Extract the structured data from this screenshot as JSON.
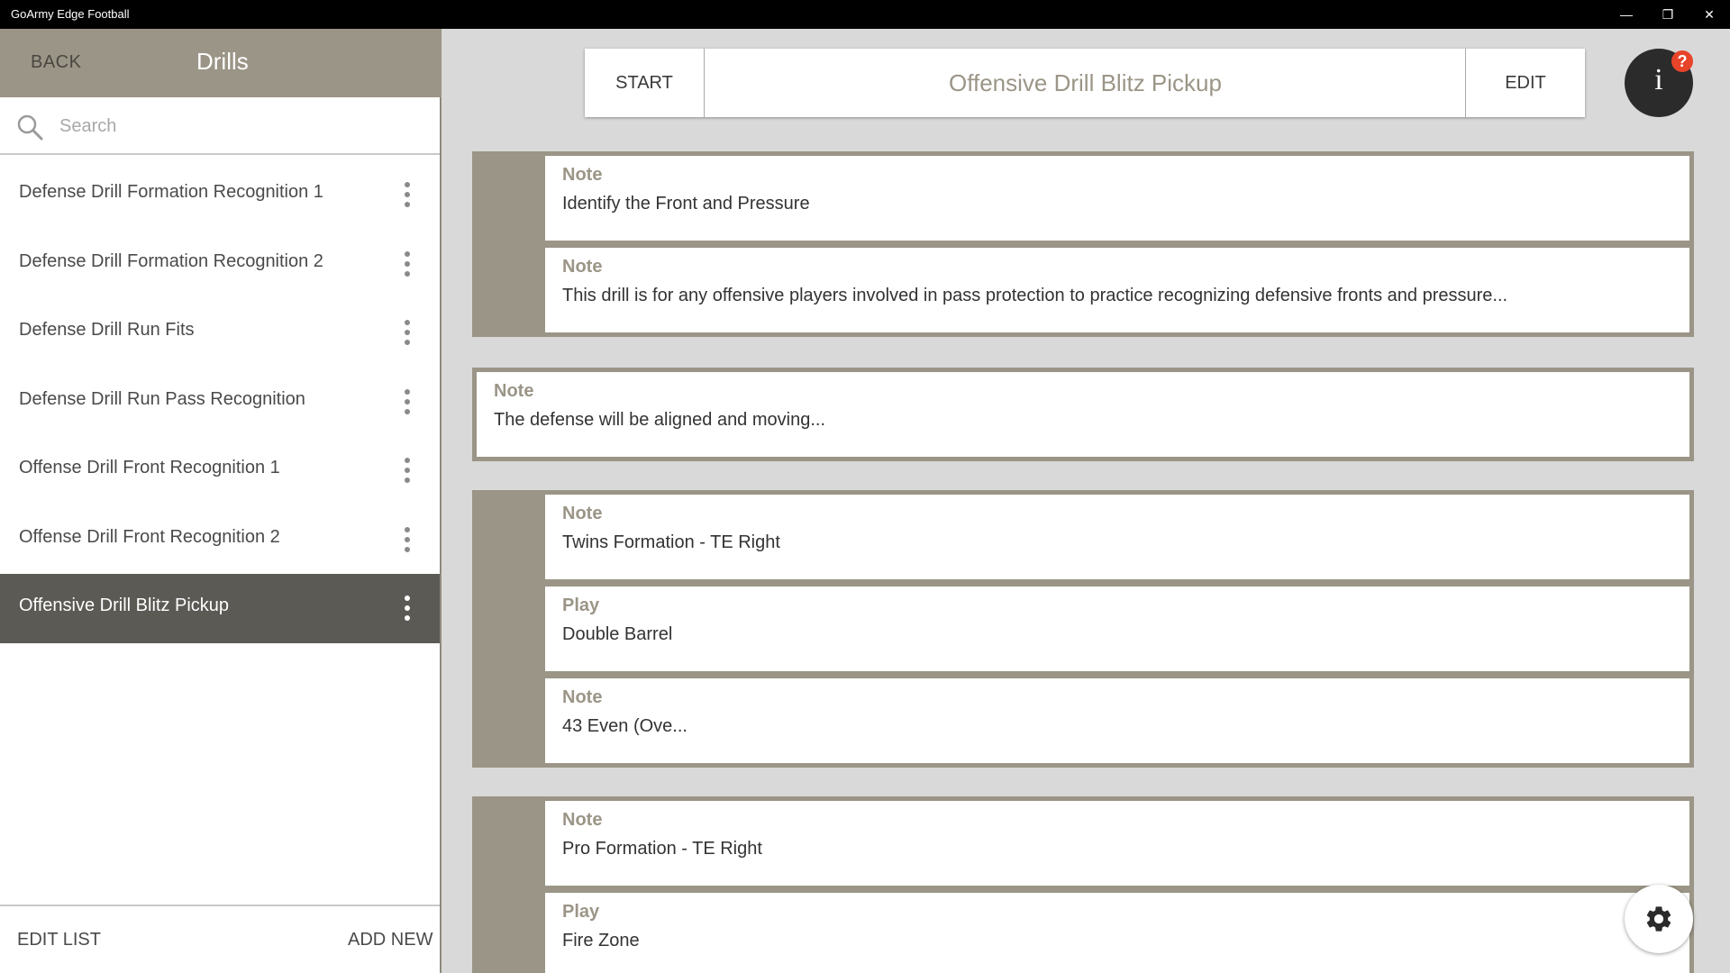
{
  "window": {
    "title": "GoArmy Edge Football",
    "minimize_glyph": "—",
    "restore_glyph": "❐",
    "close_glyph": "✕"
  },
  "sidebar": {
    "back_label": "BACK",
    "title": "Drills",
    "search_placeholder": "Search",
    "items": [
      {
        "label": "Defense Drill Formation Recognition 1",
        "selected": false
      },
      {
        "label": "Defense Drill Formation Recognition 2",
        "selected": false
      },
      {
        "label": "Defense Drill Run Fits",
        "selected": false
      },
      {
        "label": "Defense Drill Run Pass Recognition",
        "selected": false
      },
      {
        "label": "Offense Drill Front Recognition 1",
        "selected": false
      },
      {
        "label": "Offense Drill Front Recognition 2",
        "selected": false
      },
      {
        "label": "Offensive Drill Blitz Pickup",
        "selected": true
      }
    ],
    "edit_list_label": "EDIT LIST",
    "add_new_label": "ADD NEW"
  },
  "toolbar": {
    "start_label": "START",
    "drill_name": "Offensive Drill Blitz Pickup",
    "edit_label": "EDIT",
    "info_glyph": "i",
    "help_glyph": "?"
  },
  "groups": [
    {
      "cards": [
        {
          "type": "Note",
          "text": "Identify the Front and Pressure"
        },
        {
          "type": "Note",
          "text": "This drill is for any offensive players involved in pass protection to practice recognizing defensive fronts and pressure..."
        }
      ]
    },
    {
      "cards": [
        {
          "type": "Note",
          "text": "The defense will be aligned and moving..."
        }
      ]
    },
    {
      "cards": [
        {
          "type": "Note",
          "text": "Twins Formation - TE Right"
        },
        {
          "type": "Play",
          "text": "Double Barrel"
        },
        {
          "type": "Note",
          "text": "43 Even (Ove..."
        }
      ]
    },
    {
      "cards": [
        {
          "type": "Note",
          "text": "Pro Formation - TE Right"
        },
        {
          "type": "Play",
          "text": "Fire Zone"
        }
      ]
    }
  ],
  "colors": {
    "accent": "#9b9587",
    "selected_row": "#5b5a55",
    "help_badge": "#e8442a"
  }
}
